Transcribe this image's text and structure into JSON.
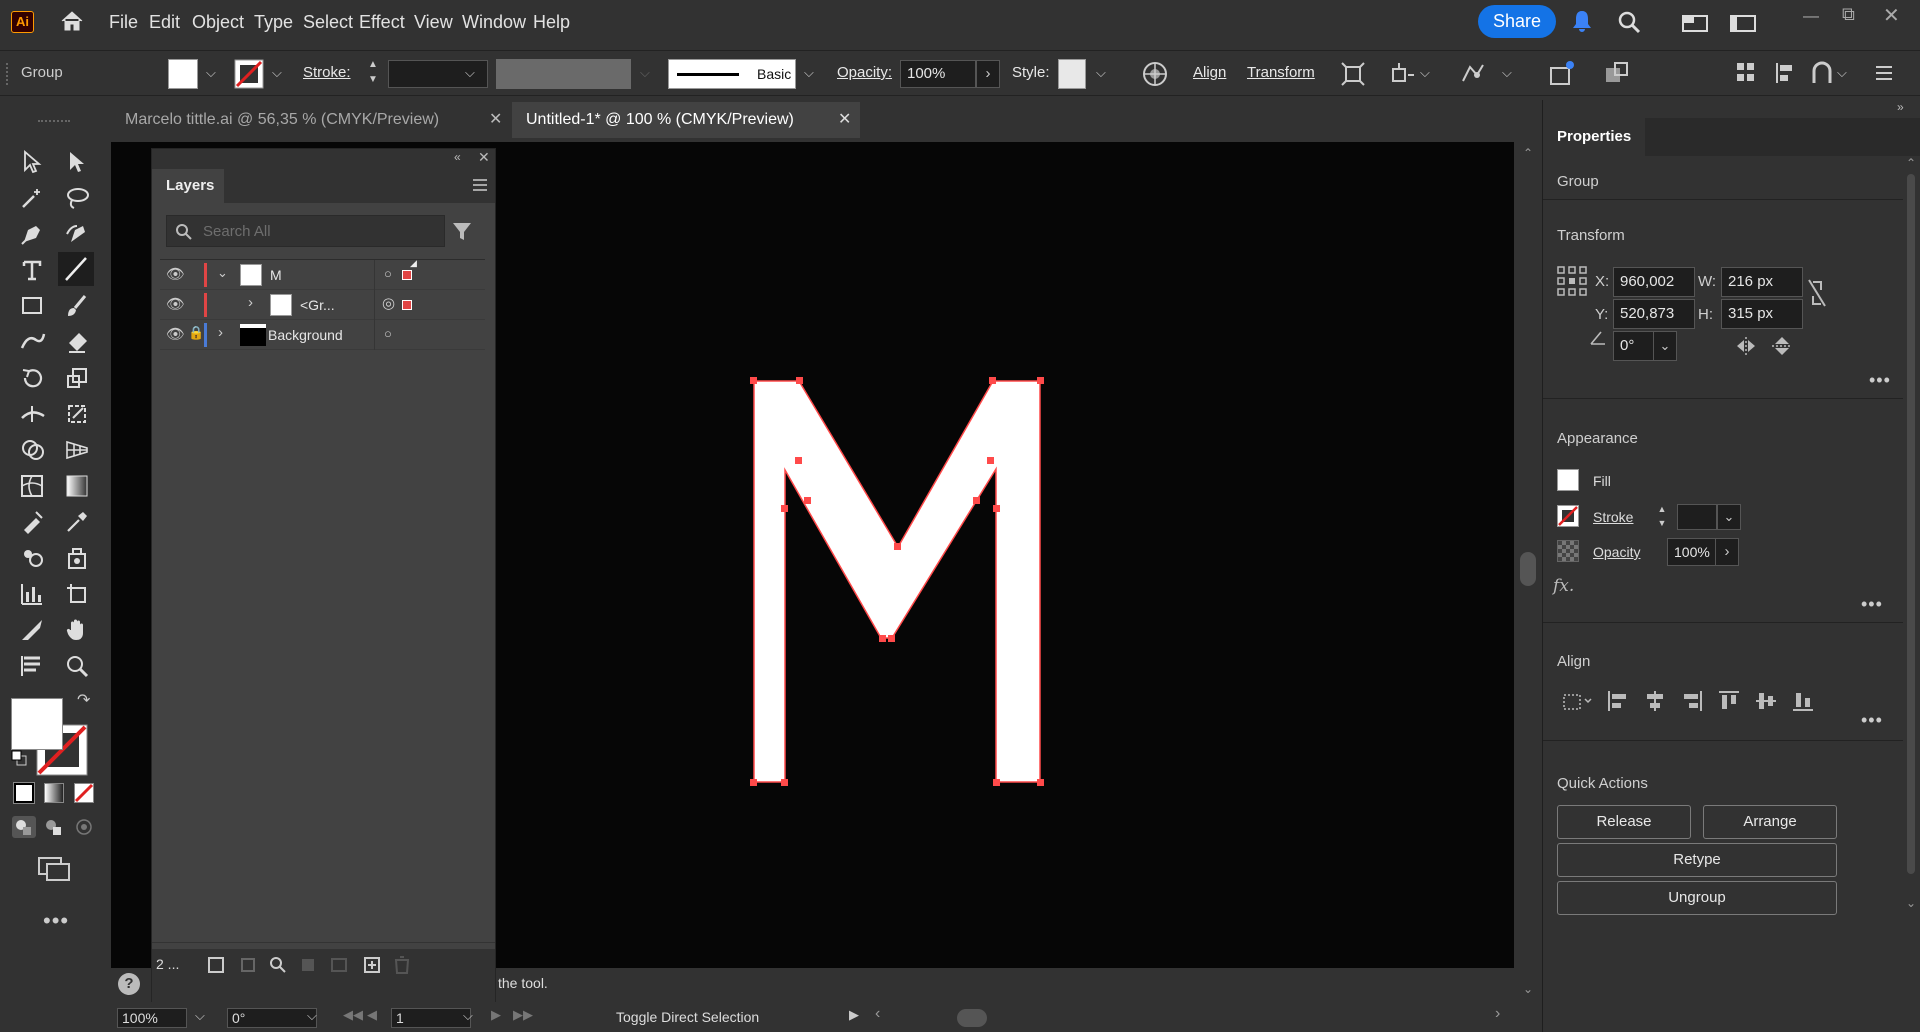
{
  "app": {
    "logo_text": "Ai"
  },
  "menu": [
    "File",
    "Edit",
    "Object",
    "Type",
    "Select",
    "Effect",
    "View",
    "Window",
    "Help"
  ],
  "share_label": "Share",
  "control_bar": {
    "selection_type": "Group",
    "stroke_label": "Stroke:",
    "brush_label": "Basic",
    "opacity_label": "Opacity:",
    "opacity_value": "100%",
    "style_label": "Style:",
    "align_label": "Align",
    "transform_label": "Transform"
  },
  "tabs": [
    {
      "label": "Marcelo tittle.ai @ 56,35 % (CMYK/Preview)",
      "active": false
    },
    {
      "label": "Untitled-1* @ 100 % (CMYK/Preview)",
      "active": true
    }
  ],
  "layers_panel": {
    "title": "Layers",
    "search_placeholder": "Search All",
    "rows": [
      {
        "name": "M",
        "color": "#e04545"
      },
      {
        "name": "<Gr...",
        "color": "#e04545"
      },
      {
        "name": "Background",
        "color": "#4a7bd6"
      }
    ],
    "layer_count": "2 ..."
  },
  "canvas": {
    "artwork_letter": "M"
  },
  "status": {
    "zoom": "100%",
    "rotation": "0°",
    "artboard": "1",
    "hint": "Toggle Direct Selection",
    "hint_partial": "the tool."
  },
  "properties": {
    "tab": "Properties",
    "selection": "Group",
    "transform_title": "Transform",
    "x_label": "X:",
    "x": "960,002 px",
    "y_label": "Y:",
    "y": "520,873 px",
    "w_label": "W:",
    "w": "216 px",
    "h_label": "H:",
    "h": "315 px",
    "angle": "0°",
    "appearance_title": "Appearance",
    "fill_label": "Fill",
    "stroke_label": "Stroke",
    "opacity_label": "Opacity",
    "opacity_value": "100%",
    "fx_label": "fx.",
    "align_title": "Align",
    "quick_actions_title": "Quick Actions",
    "release": "Release",
    "arrange": "Arrange",
    "retype": "Retype",
    "ungroup": "Ungroup"
  },
  "colors": {
    "accent": "#1473e6",
    "anchor": "#ff4a4a",
    "canvas": "#060606"
  }
}
